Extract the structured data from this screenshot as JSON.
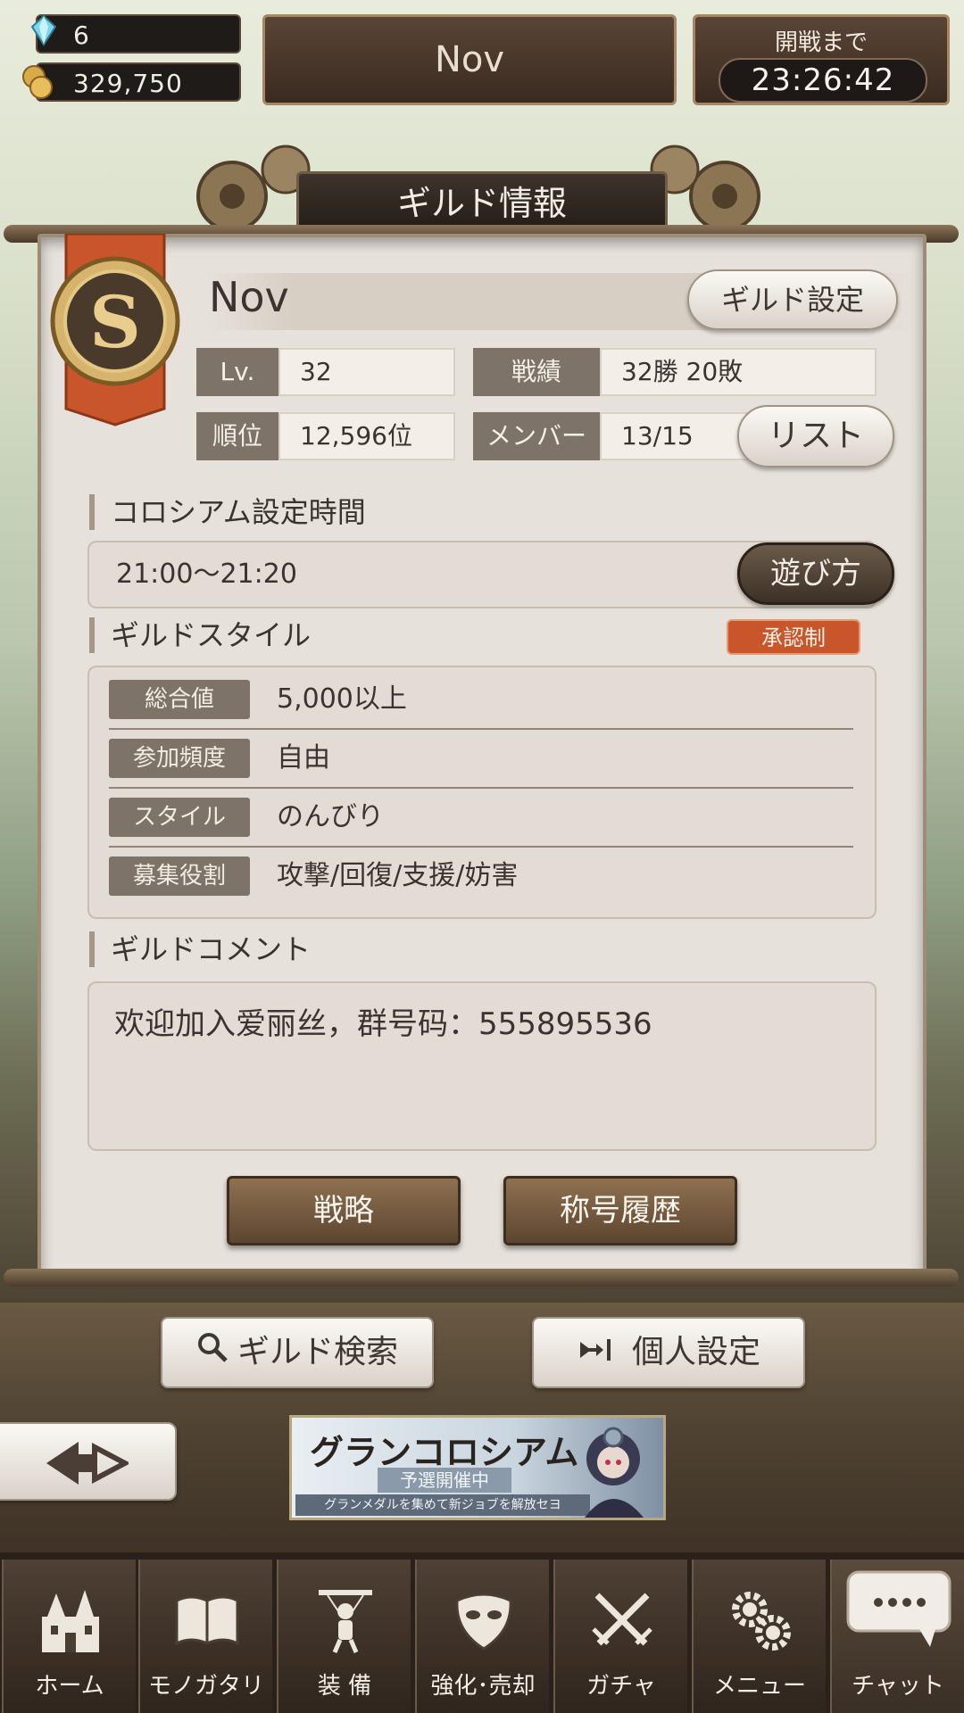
{
  "top": {
    "gems": "6",
    "coins": "329,750",
    "guild_name": "Nov",
    "battle_label": "開戦まで",
    "countdown": "23:26:42"
  },
  "panel": {
    "title": "ギルド情報",
    "rank_badge": "S",
    "guild_name": "Nov",
    "settings_button": "ギルド設定",
    "stats": {
      "level_label": "Lv.",
      "level_value": "32",
      "record_label": "戦績",
      "record_value": "32勝  20敗",
      "rank_label": "順位",
      "rank_value": "12,596位",
      "member_label": "メンバー",
      "member_value": "13/15",
      "list_button": "リスト"
    },
    "colosseum": {
      "heading": "コロシアム設定時間",
      "time": "21:00～21:20",
      "howto_button": "遊び方"
    },
    "style": {
      "heading": "ギルドスタイル",
      "badge": "承認制",
      "rows": [
        {
          "label": "総合値",
          "value": "5,000以上"
        },
        {
          "label": "参加頻度",
          "value": "自由"
        },
        {
          "label": "スタイル",
          "value": "のんびり"
        },
        {
          "label": "募集役割",
          "value": "攻撃/回復/支援/妨害"
        }
      ]
    },
    "comment": {
      "heading": "ギルドコメント",
      "text": "欢迎加入爱丽丝，群号码：555895536"
    },
    "strategy_button": "戦略",
    "title_history_button": "称号履歴"
  },
  "actions": {
    "search_button": "ギルド検索",
    "personal_button": "個人設定"
  },
  "banner": {
    "title": "グランコロシアム",
    "subtitle": "予選開催中",
    "caption": "グランメダルを集めて新ジョブを解放セヨ"
  },
  "nav": [
    {
      "label": "ホーム",
      "icon": "castle-icon"
    },
    {
      "label": "モノガタリ",
      "icon": "book-icon"
    },
    {
      "label": "装 備",
      "icon": "puppet-icon"
    },
    {
      "label": "強化･売却",
      "icon": "mask-icon"
    },
    {
      "label": "ガチャ",
      "icon": "swords-icon"
    },
    {
      "label": "メニュー",
      "icon": "gears-icon"
    },
    {
      "label": "チャット",
      "icon": "chat-icon"
    }
  ],
  "colors": {
    "accent_orange": "#c9552a",
    "panel": "#e6e1da",
    "label_gray": "#7d7368"
  }
}
